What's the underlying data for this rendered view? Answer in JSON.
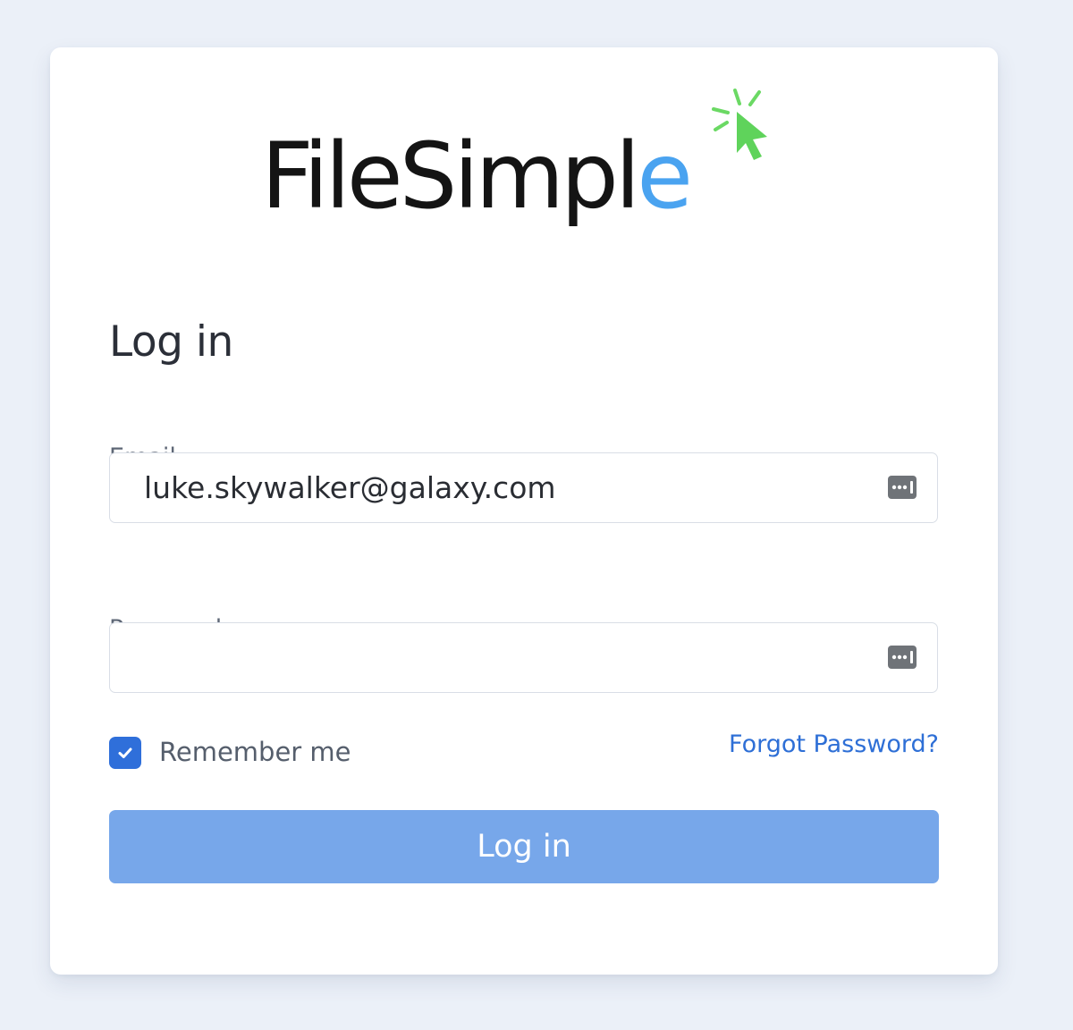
{
  "logo": {
    "text_main": "FileSimpl",
    "text_accent": "e",
    "accent_color": "#4aa3f0",
    "cursor_color": "#5fd35b",
    "icon": "cursor-click-icon"
  },
  "login": {
    "heading": "Log in",
    "email_label": "Email",
    "email_value": "luke.skywalker@galaxy.com",
    "password_label": "Password",
    "password_value": "",
    "autofill_icon": "autofill-key-icon",
    "remember_label": "Remember me",
    "remember_checked": true,
    "forgot_label": "Forgot Password?",
    "submit_label": "Log in"
  },
  "colors": {
    "background": "#ebf0f8",
    "card": "#ffffff",
    "primary": "#2f6fda",
    "button": "#77a7ea",
    "link": "#2e6fd6"
  }
}
